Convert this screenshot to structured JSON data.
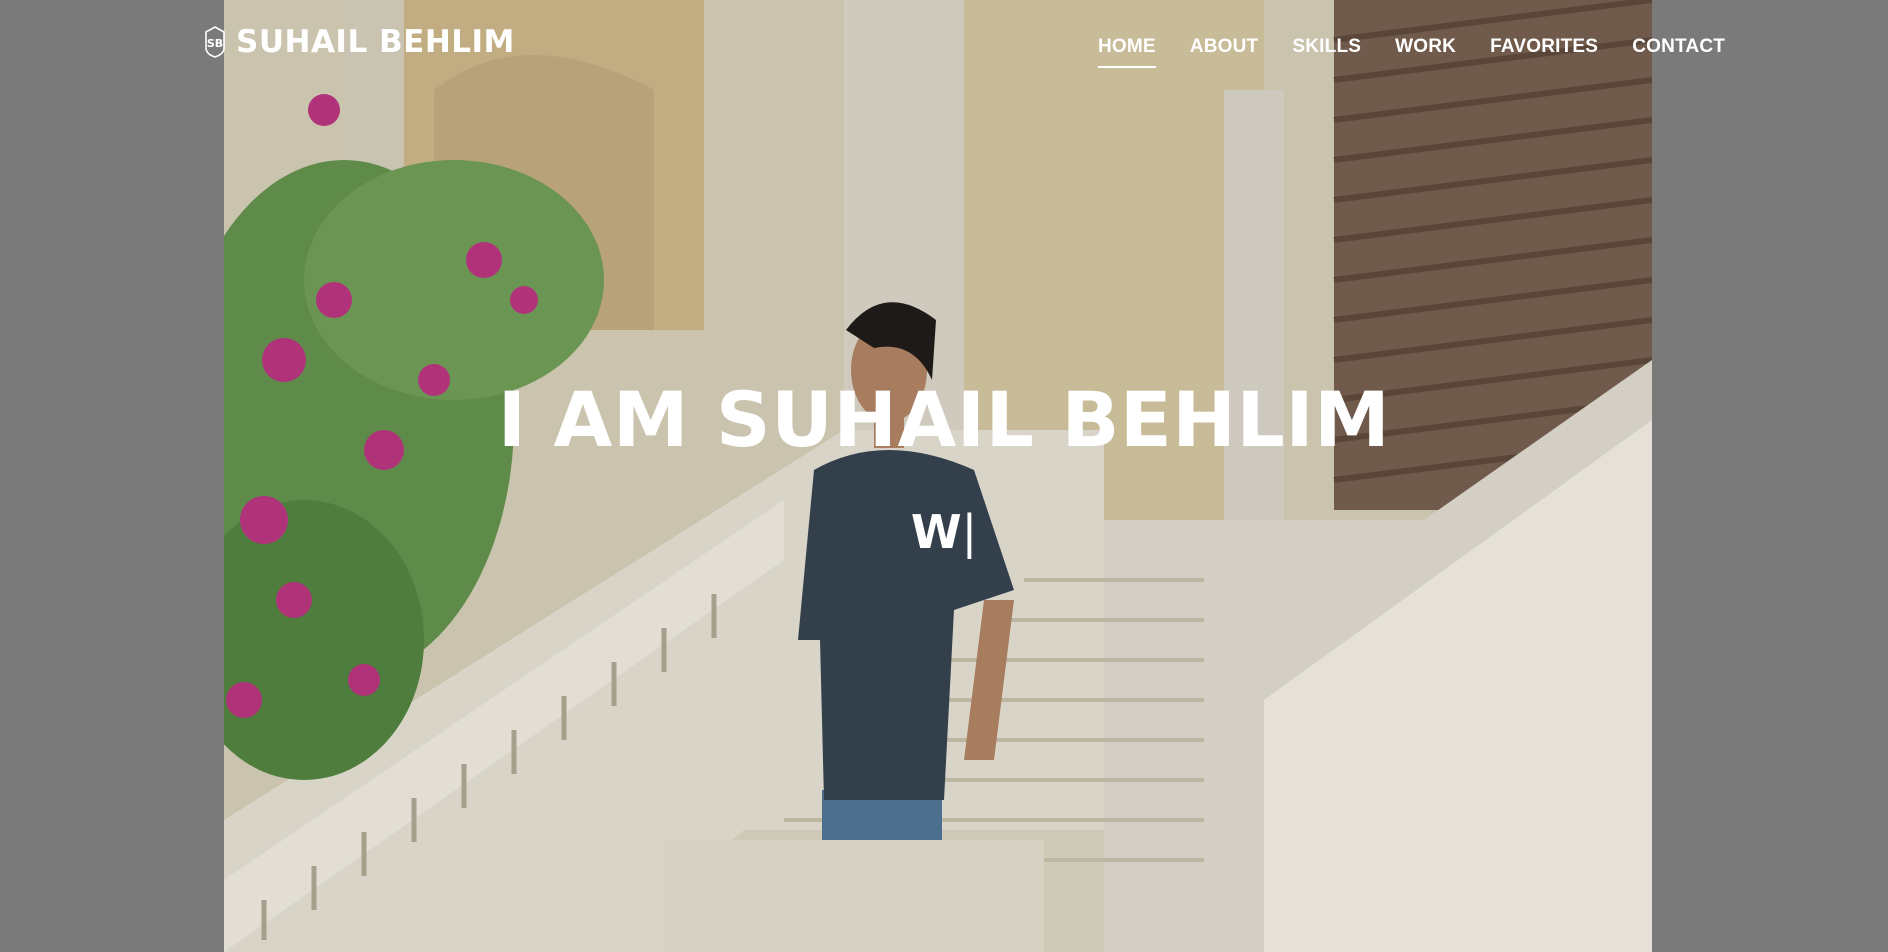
{
  "brand": {
    "logo_icon": "sb-monogram-icon",
    "name": "SUHAIL BEHLIM"
  },
  "nav": {
    "items": [
      {
        "label": "HOME",
        "active": true
      },
      {
        "label": "ABOUT",
        "active": false
      },
      {
        "label": "SKILLS",
        "active": false
      },
      {
        "label": "WORK",
        "active": false
      },
      {
        "label": "FAVORITES",
        "active": false
      },
      {
        "label": "CONTACT",
        "active": false
      }
    ]
  },
  "hero": {
    "title": "I AM SUHAIL BEHLIM",
    "typed_text": "W",
    "cursor": "|",
    "background_image": "man-standing-on-palace-staircase-with-bougainvillea"
  },
  "colors": {
    "text": "#ffffff",
    "page_background": "#7a7a7a"
  }
}
